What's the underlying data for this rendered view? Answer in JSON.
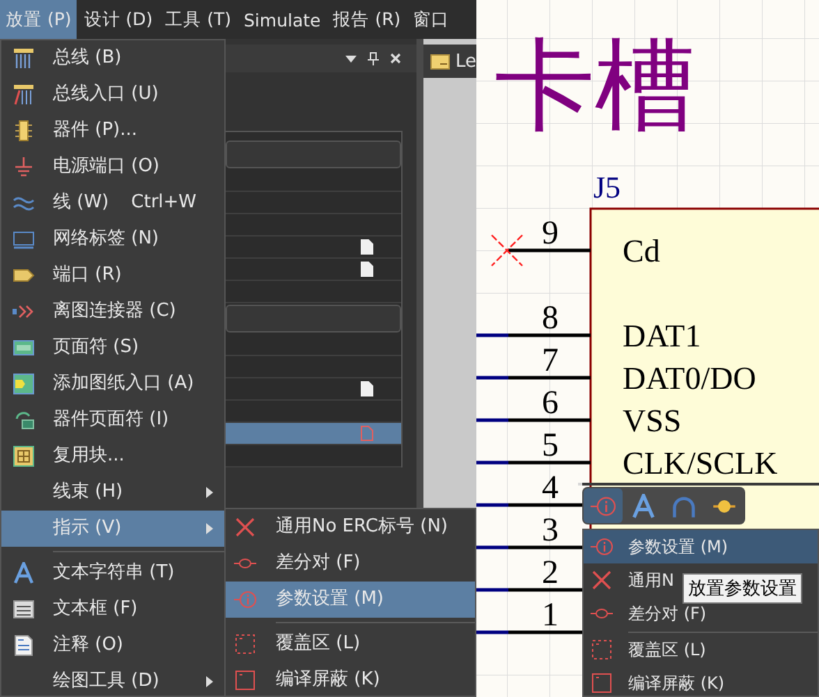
{
  "menubar": {
    "items": [
      {
        "label": "放置 (P)",
        "selected": true
      },
      {
        "label": "设计 (D)",
        "selected": false
      },
      {
        "label": "工具 (T)",
        "selected": false
      },
      {
        "label": "Simulate",
        "selected": false
      },
      {
        "label": "报告 (R)",
        "selected": false
      },
      {
        "label": "窗口",
        "selected": false
      }
    ]
  },
  "panel": {
    "tab": "Le",
    "rows": [
      {
        "kind": "field"
      },
      {
        "kind": "row",
        "file": false,
        "selected": false
      },
      {
        "kind": "row",
        "file": false,
        "selected": false
      },
      {
        "kind": "row",
        "file": false,
        "selected": false
      },
      {
        "kind": "row",
        "file": true,
        "selected": false
      },
      {
        "kind": "row",
        "file": true,
        "selected": false
      },
      {
        "kind": "row",
        "file": false,
        "selected": false
      },
      {
        "kind": "field"
      },
      {
        "kind": "row",
        "file": false,
        "selected": false
      },
      {
        "kind": "row",
        "file": false,
        "selected": false
      },
      {
        "kind": "row",
        "file": true,
        "selected": false
      },
      {
        "kind": "row",
        "file": false,
        "selected": false
      },
      {
        "kind": "row",
        "file": true,
        "selected": true
      },
      {
        "kind": "row",
        "file": false,
        "selected": false
      }
    ]
  },
  "place_menu": {
    "items": [
      {
        "kind": "item",
        "label": "总线 (B)",
        "submenu": false,
        "selected": false
      },
      {
        "kind": "item",
        "label": "总线入口 (U)",
        "submenu": false,
        "selected": false
      },
      {
        "kind": "item",
        "label": "器件 (P)...",
        "submenu": false,
        "selected": false
      },
      {
        "kind": "item",
        "label": "电源端口 (O)",
        "submenu": false,
        "selected": false
      },
      {
        "kind": "item",
        "label": "线 (W)",
        "shortcut": "Ctrl+W",
        "submenu": false,
        "selected": false
      },
      {
        "kind": "item",
        "label": "网络标签 (N)",
        "submenu": false,
        "selected": false
      },
      {
        "kind": "item",
        "label": "端口 (R)",
        "submenu": false,
        "selected": false
      },
      {
        "kind": "item",
        "label": "离图连接器 (C)",
        "submenu": false,
        "selected": false
      },
      {
        "kind": "item",
        "label": "页面符 (S)",
        "submenu": false,
        "selected": false
      },
      {
        "kind": "item",
        "label": "添加图纸入口 (A)",
        "submenu": false,
        "selected": false
      },
      {
        "kind": "item",
        "label": "器件页面符 (I)",
        "submenu": false,
        "selected": false
      },
      {
        "kind": "item",
        "label": "复用块...",
        "submenu": false,
        "selected": false
      },
      {
        "kind": "item",
        "label": "线束 (H)",
        "submenu": true,
        "selected": false
      },
      {
        "kind": "item",
        "label": "指示 (V)",
        "submenu": true,
        "selected": true
      },
      {
        "kind": "separator"
      },
      {
        "kind": "item",
        "label": "文本字符串 (T)",
        "submenu": false,
        "selected": false
      },
      {
        "kind": "item",
        "label": "文本框 (F)",
        "submenu": false,
        "selected": false
      },
      {
        "kind": "item",
        "label": "注释 (O)",
        "submenu": false,
        "selected": false
      },
      {
        "kind": "item",
        "label": "绘图工具 (D)",
        "submenu": true,
        "selected": false
      }
    ]
  },
  "directive_menu": {
    "items": [
      {
        "kind": "item",
        "label": "通用No ERC标号 (N)",
        "selected": false
      },
      {
        "kind": "item",
        "label": "差分对 (F)",
        "selected": false
      },
      {
        "kind": "item",
        "label": "参数设置 (M)",
        "selected": true
      },
      {
        "kind": "separator"
      },
      {
        "kind": "item",
        "label": "覆盖区 (L)",
        "selected": false
      },
      {
        "kind": "item",
        "label": "编译屏蔽 (K)",
        "selected": false
      }
    ]
  },
  "schematic": {
    "title": "卡槽",
    "designator": "J5",
    "pins": [
      {
        "number": "9",
        "name": "Cd",
        "no_erc": true,
        "wired": false
      },
      {
        "number": "8",
        "name": "DAT1",
        "no_erc": false,
        "wired": true
      },
      {
        "number": "7",
        "name": "DAT0/DO",
        "no_erc": false,
        "wired": true
      },
      {
        "number": "6",
        "name": "VSS",
        "no_erc": false,
        "wired": true
      },
      {
        "number": "5",
        "name": "CLK/SCLK",
        "no_erc": false,
        "wired": true
      },
      {
        "number": "4",
        "no_erc": false,
        "wired": true
      },
      {
        "number": "3",
        "no_erc": false,
        "wired": true
      },
      {
        "number": "2",
        "no_erc": false,
        "wired": true
      },
      {
        "number": "1",
        "no_erc": false,
        "wired": true
      }
    ]
  },
  "popup": {
    "toolbar": [
      {
        "selected": true
      },
      {
        "selected": false
      },
      {
        "selected": false
      },
      {
        "selected": false
      }
    ],
    "menu": {
      "items": [
        {
          "kind": "item",
          "label": "参数设置 (M)",
          "selected": true
        },
        {
          "kind": "item",
          "label": "通用N",
          "selected": false
        },
        {
          "kind": "item",
          "label": "差分对 (F)",
          "selected": false
        },
        {
          "kind": "separator"
        },
        {
          "kind": "item",
          "label": "覆盖区 (L)",
          "selected": false
        },
        {
          "kind": "item",
          "label": "编译屏蔽 (K)",
          "selected": false
        }
      ]
    },
    "tooltip": "放置参数设置"
  }
}
